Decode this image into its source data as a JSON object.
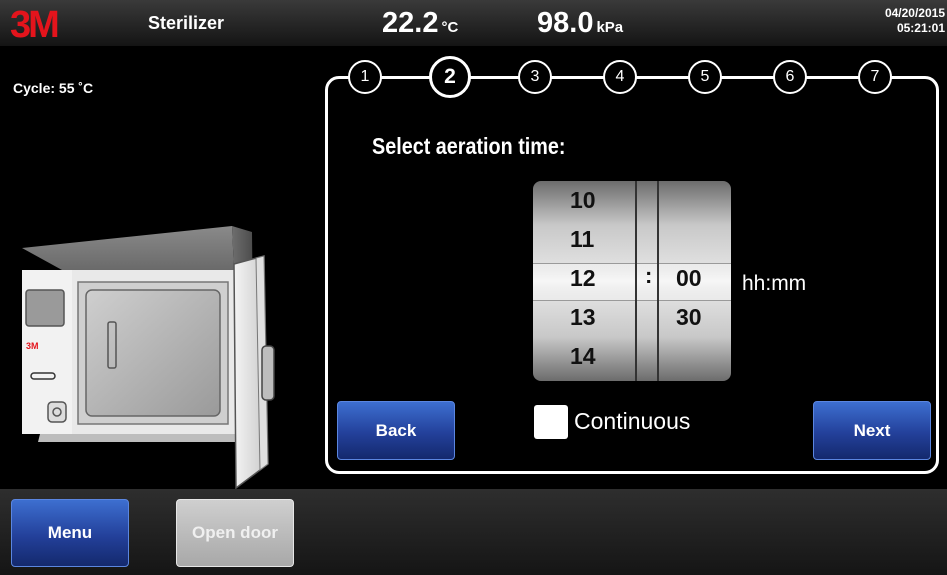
{
  "header": {
    "brand": "3M",
    "title": "Sterilizer",
    "temperature": {
      "value": "22.2",
      "unit": "°C"
    },
    "pressure": {
      "value": "98.0",
      "unit": "kPa"
    },
    "date": "04/20/2015",
    "time": "05:21:01"
  },
  "cycle_label": "Cycle: 55 ˚C",
  "device_brand": "3M",
  "steps": {
    "items": [
      "1",
      "2",
      "3",
      "4",
      "5",
      "6",
      "7"
    ],
    "active_index": 1
  },
  "prompt": "Select aeration time:",
  "time_picker": {
    "hours": [
      "10",
      "11",
      "12",
      "13",
      "14"
    ],
    "minutes": [
      "00",
      "30"
    ],
    "separator": ":",
    "selected_hours": "12",
    "selected_minutes": "00",
    "unit_label": "hh:mm"
  },
  "continuous": {
    "label": "Continuous",
    "checked": false
  },
  "buttons": {
    "back": "Back",
    "next": "Next",
    "menu": "Menu",
    "open_door": "Open door"
  },
  "colors": {
    "brand_red": "#e4141c",
    "button_blue": "#23409a",
    "disabled_gray": "#b8b8b8"
  }
}
